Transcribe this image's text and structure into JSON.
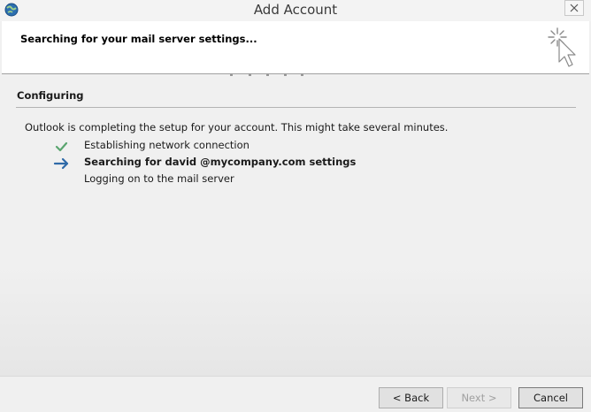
{
  "window": {
    "title": "Add Account",
    "icon": "outlook-globe-icon"
  },
  "header": {
    "title": "Searching for your mail server settings...",
    "busy_icon": "busy-cursor-icon"
  },
  "section": {
    "title": "Configuring",
    "description": "Outlook is completing the setup for your account. This might take several minutes."
  },
  "steps": [
    {
      "icon": "checkmark-icon",
      "label": "Establishing network connection",
      "state": "done"
    },
    {
      "icon": "arrow-right-icon",
      "label": "Searching for david @mycompany.com settings",
      "state": "active"
    },
    {
      "icon": "",
      "label": "Logging on to the mail server",
      "state": "pending"
    }
  ],
  "buttons": {
    "back": "< Back",
    "next": "Next >",
    "cancel": "Cancel"
  },
  "colors": {
    "check": "#5aa56f",
    "arrow": "#2f6aa8",
    "header_bg": "#ffffff",
    "window_bg": "#f0f0f0"
  }
}
